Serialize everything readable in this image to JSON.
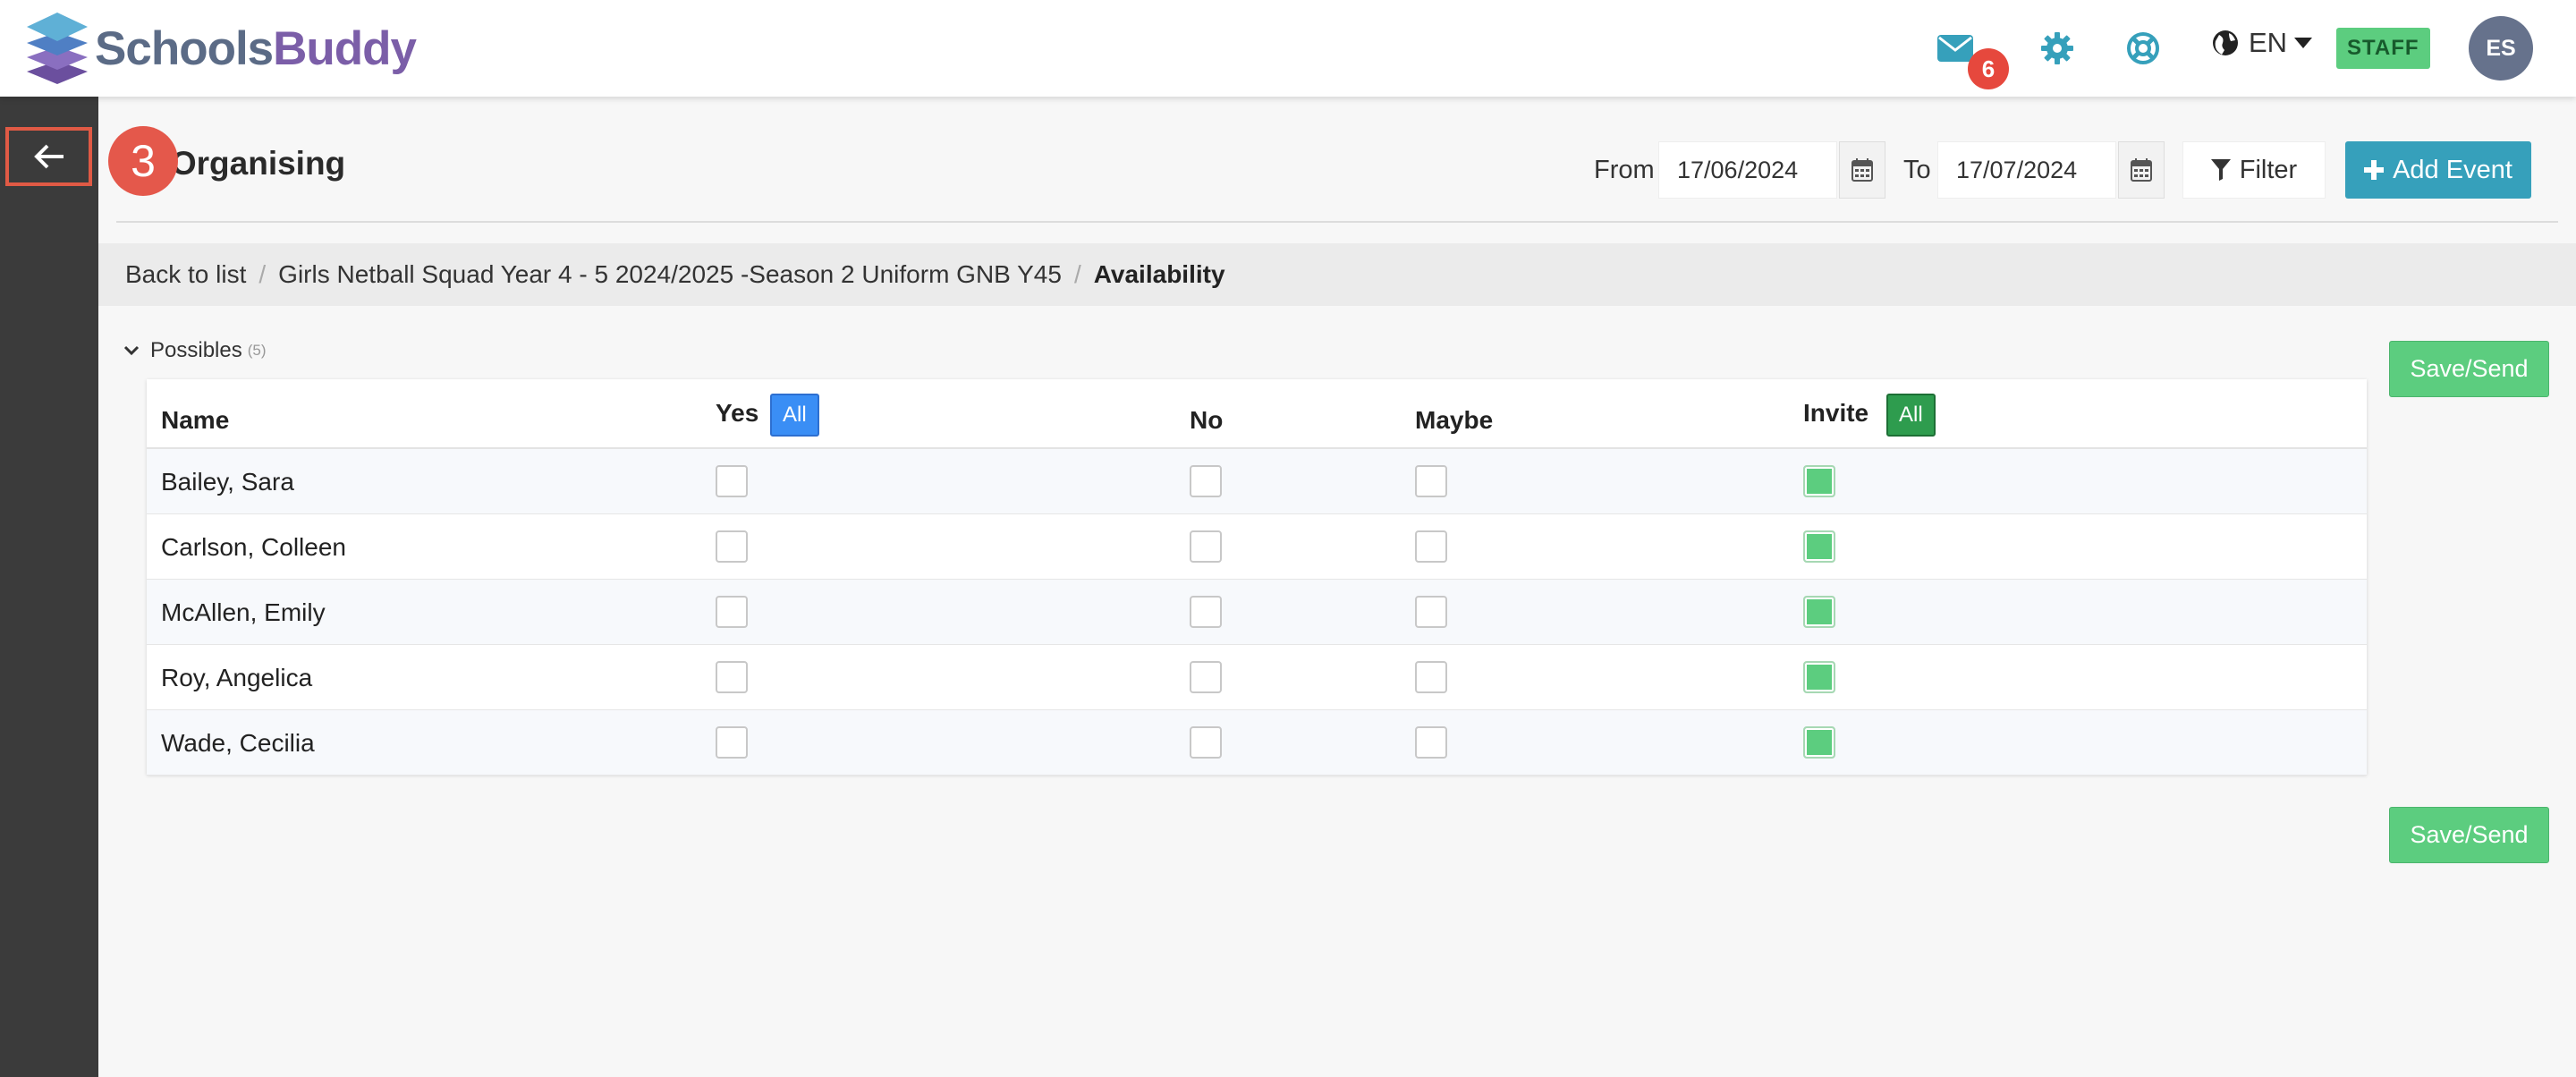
{
  "app": {
    "brand_part1": "Schools",
    "brand_part2": "Buddy"
  },
  "header": {
    "mail_count": "6",
    "language": "EN",
    "role_badge": "STAFF",
    "user_initials": "ES"
  },
  "overlay": {
    "step_number": "3"
  },
  "page": {
    "title": "y Organising",
    "from_label": "From",
    "from_date": "17/06/2024",
    "to_label": "To",
    "to_date": "17/07/2024",
    "filter_label": "Filter",
    "add_event_label": "Add Event"
  },
  "breadcrumb": {
    "items": [
      "Back to list",
      "Girls Netball Squad Year 4 - 5 2024/2025 -Season 2 Uniform GNB Y45",
      "Availability"
    ]
  },
  "section": {
    "title": "Possibles",
    "count": "(5)",
    "save_label": "Save/Send"
  },
  "table": {
    "columns": {
      "name": "Name",
      "yes": "Yes",
      "no": "No",
      "maybe": "Maybe",
      "invite": "Invite",
      "all_label": "All"
    },
    "rows": [
      {
        "name": "Bailey, Sara",
        "yes": false,
        "no": false,
        "maybe": false,
        "invite": true
      },
      {
        "name": "Carlson, Colleen",
        "yes": false,
        "no": false,
        "maybe": false,
        "invite": true
      },
      {
        "name": "McAllen, Emily",
        "yes": false,
        "no": false,
        "maybe": false,
        "invite": true
      },
      {
        "name": "Roy, Angelica",
        "yes": false,
        "no": false,
        "maybe": false,
        "invite": true
      },
      {
        "name": "Wade, Cecilia",
        "yes": false,
        "no": false,
        "maybe": false,
        "invite": true
      }
    ]
  },
  "colors": {
    "accent_teal": "#36a0bb",
    "save_green": "#5ccd7f",
    "badge_red": "#e6483d",
    "sidebar_dark": "#3b3b3b"
  }
}
